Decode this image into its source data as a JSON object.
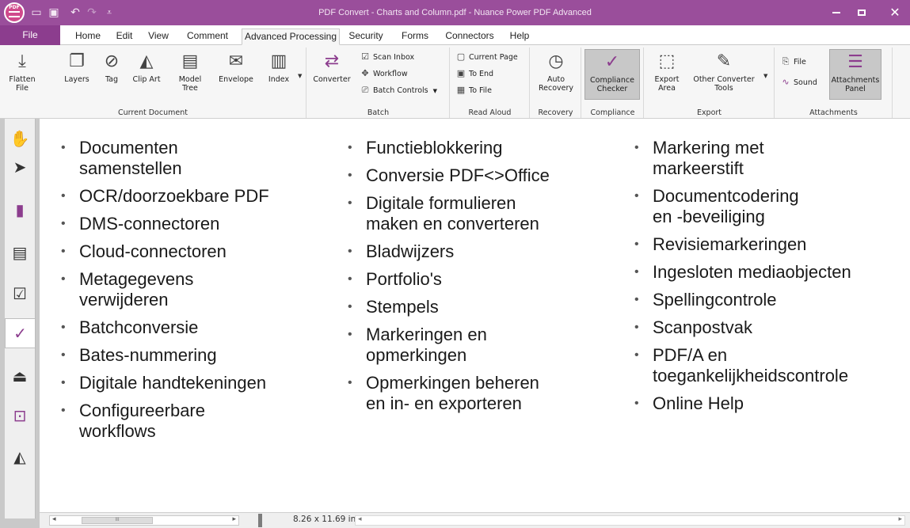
{
  "app": {
    "window_title": "PDF Convert - Charts and Column.pdf - Nuance Power PDF Advanced",
    "logo_text": "PDF"
  },
  "quick_access": {
    "open_icon": "folder-open-icon",
    "save_icon": "save-icon",
    "undo_icon": "undo-icon",
    "redo_icon": "redo-icon",
    "customize_icon": "customize-toolbar-icon"
  },
  "tabs": [
    "File",
    "Home",
    "Edit",
    "View",
    "Comment",
    "Advanced Processing",
    "Security",
    "Forms",
    "Connectors",
    "Help"
  ],
  "active_tab": "Advanced Processing",
  "ribbon": {
    "current_document": {
      "label": "Current Document",
      "buttons": [
        {
          "label": "Flatten\nFile",
          "icon": "flatten-icon"
        },
        {
          "label": "Layers",
          "icon": "layers-icon"
        },
        {
          "label": "Tag",
          "icon": "tag-icon"
        },
        {
          "label": "Clip Art",
          "icon": "clip-art-icon"
        },
        {
          "label": "Model\nTree",
          "icon": "model-tree-icon"
        },
        {
          "label": "Envelope",
          "icon": "envelope-icon"
        },
        {
          "label": "Index",
          "icon": "index-icon"
        }
      ]
    },
    "batch": {
      "label": "Batch",
      "converter": "Converter",
      "items": [
        "Scan Inbox",
        "Workflow",
        "Batch Controls"
      ]
    },
    "read_aloud": {
      "label": "Read Aloud",
      "items": [
        "Current Page",
        "To End",
        "To File"
      ]
    },
    "recovery": {
      "label": "Recovery",
      "button": "Auto\nRecovery"
    },
    "compliance": {
      "label": "Compliance",
      "button": "Compliance\nChecker"
    },
    "export": {
      "label": "Export",
      "buttons": [
        "Export\nArea",
        "Other Converter\nTools"
      ]
    },
    "attachments": {
      "label": "Attachments",
      "items": [
        "File",
        "Sound"
      ],
      "panel_button": "Attachments\nPanel"
    }
  },
  "left_nav": [
    "hand-tool-icon",
    "select-arrow-icon",
    "bookmarks-icon",
    "pages-icon",
    "comments-icon",
    "compliance-check-icon",
    "stamp-icon",
    "security-lock-icon",
    "clip-art-icon"
  ],
  "document": {
    "column1": [
      "Documenten\nsamenstellen",
      "OCR/doorzoekbare PDF",
      "DMS-connectoren",
      "Cloud-connectoren",
      "Metagegevens\nverwijderen",
      "Batchconversie",
      "Bates-nummering",
      "Digitale handtekeningen",
      "Configureerbare\nworkflows"
    ],
    "column2": [
      "Functieblokkering",
      "Conversie PDF<>Office",
      "Digitale formulieren\nmaken en converteren",
      "Bladwijzers",
      "Portfolio's",
      "Stempels",
      "Markeringen en\nopmerkingen",
      "Opmerkingen beheren\nen in- en exporteren"
    ],
    "column3": [
      "Markering met\nmarkeerstift",
      "Documentcodering\nen -beveiliging",
      "Revisiemarkeringen",
      "Ingesloten mediaobjecten",
      "Spellingcontrole",
      "Scanpostvak",
      "PDF/A en\ntoegankelijkheidscontrole",
      "Online Help"
    ]
  },
  "status": {
    "page_size": "8.26 x 11.69 in",
    "scroll_thumb_grip": "III"
  }
}
